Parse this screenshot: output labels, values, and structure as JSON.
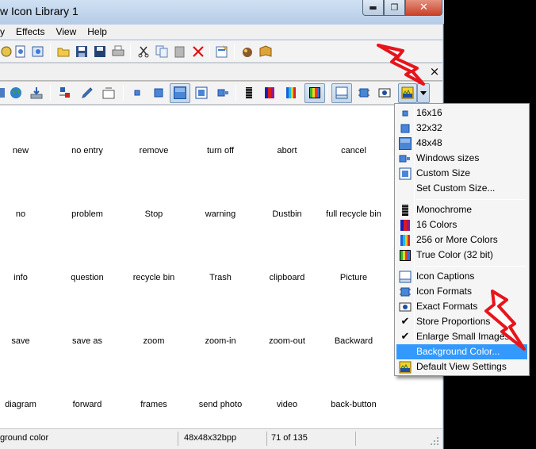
{
  "window": {
    "title": "w Icon Library 1",
    "controls": {
      "minimize": "▬",
      "maximize": "❐",
      "close": "✕"
    }
  },
  "menubar": {
    "items": [
      "y",
      "Effects",
      "View",
      "Help"
    ]
  },
  "tab_close": "×",
  "icons": {
    "grid": [
      [
        "new",
        "no entry",
        "remove",
        "turn off",
        "abort",
        "cancel"
      ],
      [
        "no",
        "problem",
        "Stop",
        "warning",
        "Dustbin",
        "full recycle bin"
      ],
      [
        "info",
        "question",
        "recycle bin",
        "Trash",
        "clipboard",
        "Picture"
      ],
      [
        "save",
        "save as",
        "zoom",
        "zoom-in",
        "zoom-out",
        "Backward"
      ],
      [
        "diagram",
        "forward",
        "frames",
        "send photo",
        "video",
        "back-button"
      ]
    ]
  },
  "statusbar": {
    "message": "ground color",
    "format": "48x48x32bpp",
    "position": "71 of 135"
  },
  "view_menu": {
    "size_items": [
      "16x16",
      "32x32",
      "48x48",
      "Windows sizes",
      "Custom Size",
      "Set Custom Size..."
    ],
    "color_items": [
      "Monochrome",
      "16 Colors",
      "256 or More Colors",
      "True Color (32 bit)"
    ],
    "option_items": [
      "Icon Captions",
      "Icon Formats",
      "Exact Formats",
      "Store Proportions",
      "Enlarge Small Images",
      "Background Color...",
      "Default View Settings"
    ],
    "checked": [
      "Store Proportions",
      "Enlarge Small Images"
    ],
    "highlighted": "Background Color...",
    "check_glyph": "✔"
  },
  "colors": {
    "highlight": "#3399ff",
    "annotation_bolt": "#e8141b"
  }
}
